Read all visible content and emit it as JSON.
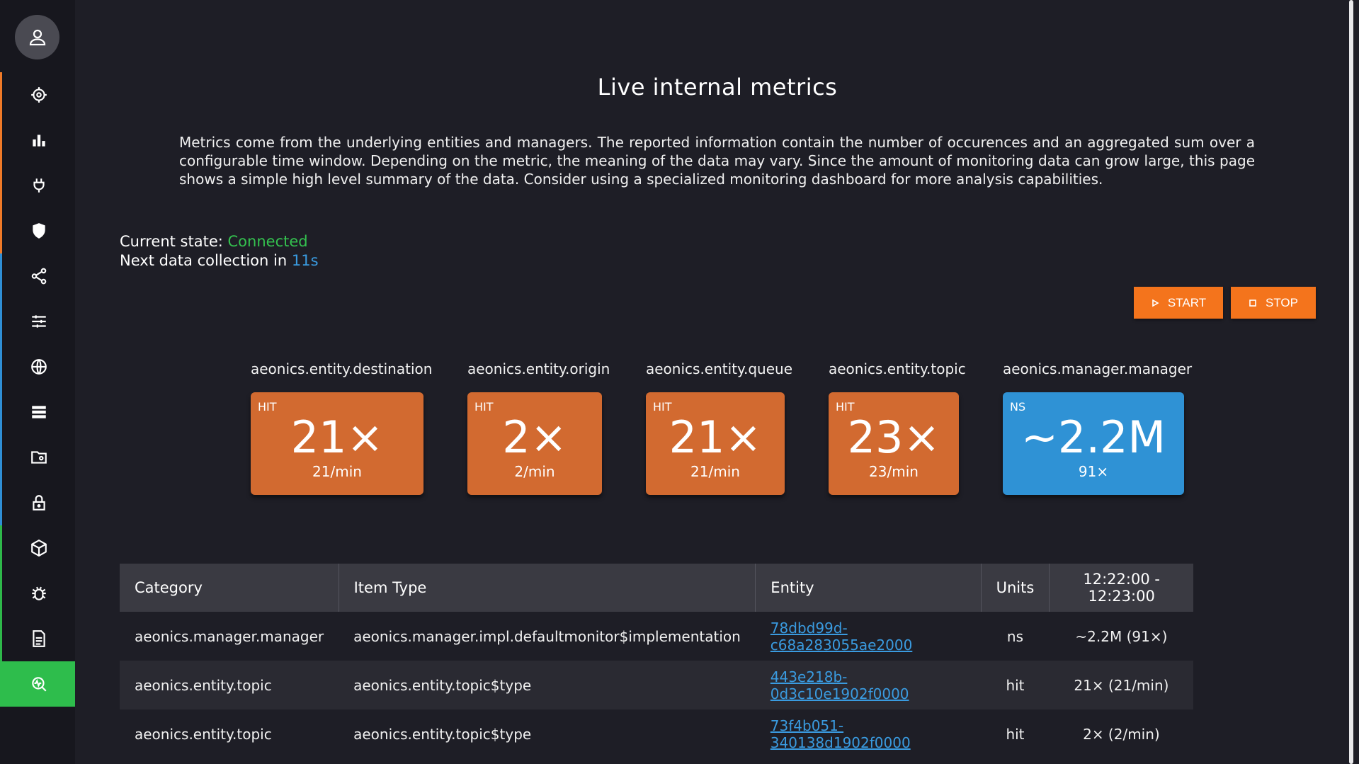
{
  "sidebar": {
    "items": [
      {
        "icon": "target-icon",
        "name": "sidebar-item-target",
        "accent": "orange"
      },
      {
        "icon": "bar-chart-icon",
        "name": "sidebar-item-stats",
        "accent": "orange"
      },
      {
        "icon": "plug-icon",
        "name": "sidebar-item-connectors",
        "accent": "orange"
      },
      {
        "icon": "shield-icon",
        "name": "sidebar-item-security",
        "accent": "orange"
      },
      {
        "icon": "share-icon",
        "name": "sidebar-item-flows",
        "accent": "blue"
      },
      {
        "icon": "sliders-icon",
        "name": "sidebar-item-settings",
        "accent": "blue"
      },
      {
        "icon": "globe-icon",
        "name": "sidebar-item-network",
        "accent": "blue"
      },
      {
        "icon": "server-icon",
        "name": "sidebar-item-servers",
        "accent": "blue"
      },
      {
        "icon": "folder-icon",
        "name": "sidebar-item-files",
        "accent": "blue"
      },
      {
        "icon": "lock-icon",
        "name": "sidebar-item-locks",
        "accent": "blue"
      },
      {
        "icon": "cube-icon",
        "name": "sidebar-item-packages",
        "accent": "green"
      },
      {
        "icon": "bug-icon",
        "name": "sidebar-item-debug",
        "accent": "green"
      },
      {
        "icon": "document-icon",
        "name": "sidebar-item-logs",
        "accent": "green"
      },
      {
        "icon": "monitor-search-icon",
        "name": "sidebar-item-metrics",
        "accent": "active"
      }
    ]
  },
  "page": {
    "title": "Live internal metrics",
    "description": "Metrics come from the underlying entities and managers. The reported information contain the number of occurences and an aggregated sum over a configurable time window. Depending on the metric, the meaning of the data may vary. Since the amount of monitoring data can grow large, this page shows a simple high level summary of the data. Consider using a specialized monitoring dashboard for more analysis capabilities."
  },
  "status": {
    "state_label": "Current state:",
    "state_value": "Connected",
    "next_label": "Next data collection in",
    "next_value": "11s"
  },
  "actions": {
    "start_label": "START",
    "stop_label": "STOP"
  },
  "metrics": [
    {
      "label": "aeonics.entity.destination",
      "kind": "HIT",
      "value": "21×",
      "rate": "21/min"
    },
    {
      "label": "aeonics.entity.origin",
      "kind": "HIT",
      "value": "2×",
      "rate": "2/min"
    },
    {
      "label": "aeonics.entity.queue",
      "kind": "HIT",
      "value": "21×",
      "rate": "21/min"
    },
    {
      "label": "aeonics.entity.topic",
      "kind": "HIT",
      "value": "23×",
      "rate": "23/min"
    },
    {
      "label": "aeonics.manager.manager",
      "kind": "NS",
      "value": "~2.2M",
      "rate": "91×"
    }
  ],
  "table": {
    "headers": [
      "Category",
      "Item Type",
      "Entity",
      "Units",
      "12:22:00 - 12:23:00"
    ],
    "rows": [
      {
        "category": "aeonics.manager.manager",
        "type": "aeonics.manager.impl.defaultmonitor$implementation",
        "entity": "78dbd99d-c68a283055ae2000",
        "units": "ns",
        "value": "~2.2M (91×)"
      },
      {
        "category": "aeonics.entity.topic",
        "type": "aeonics.entity.topic$type",
        "entity": "443e218b-0d3c10e1902f0000",
        "units": "hit",
        "value": "21× (21/min)"
      },
      {
        "category": "aeonics.entity.topic",
        "type": "aeonics.entity.topic$type",
        "entity": "73f4b051-340138d1902f0000",
        "units": "hit",
        "value": "2× (2/min)"
      }
    ]
  },
  "colors": {
    "orange": "#f4741c",
    "card_orange": "#d26a30",
    "blue": "#2f92d5",
    "green": "#2ebd4c"
  }
}
